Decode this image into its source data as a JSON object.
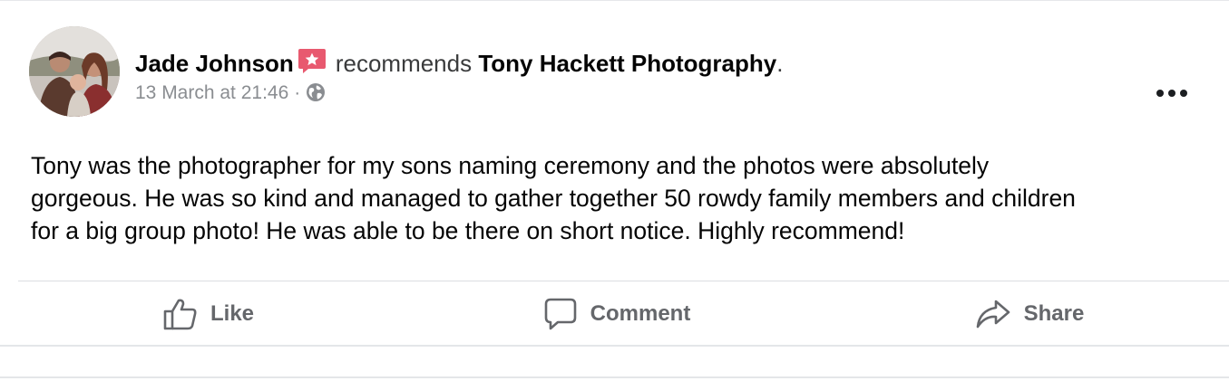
{
  "post": {
    "author": "Jade Johnson",
    "recommends_text": "recommends",
    "page_name": "Tony Hackett Photography",
    "period": ".",
    "timestamp": "13 March at 21:46",
    "separator": "·",
    "privacy_icon": "globe-icon",
    "recommend_badge_icon": "star-badge-icon",
    "body": "Tony was the photographer for my sons naming ceremony and the photos were absolutely\ngorgeous. He was so kind and managed to gather together 50 rowdy family members and children\nfor a big group photo! He was able to be there on short notice. Highly recommend!"
  },
  "actions": {
    "like_label": "Like",
    "comment_label": "Comment",
    "share_label": "Share"
  },
  "colors": {
    "badge": "#e8596f",
    "secondary_text": "#65676b",
    "meta_text": "#8a8d91"
  }
}
